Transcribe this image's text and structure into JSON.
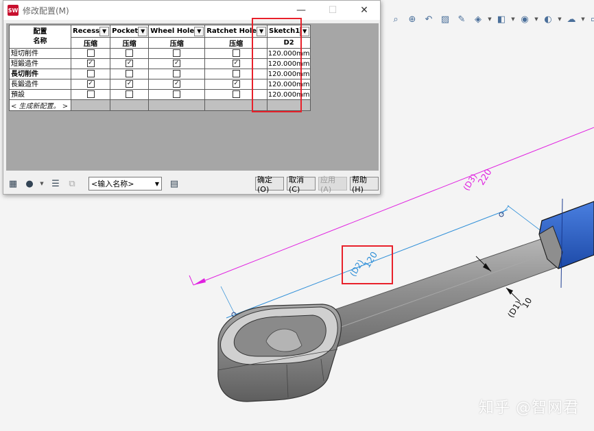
{
  "dialog": {
    "title": "修改配置(M)",
    "logo_text": "SW",
    "window_controls": {
      "minimize": "—",
      "maximize": "☐",
      "close": "✕"
    },
    "name_column_header_line1": "配置",
    "name_column_header_line2": "名称",
    "features": [
      {
        "name": "Recess",
        "param": "压缩"
      },
      {
        "name": "Pocket",
        "param": "压缩"
      },
      {
        "name": "Wheel Hole",
        "param": "压缩"
      },
      {
        "name": "Ratchet Hole",
        "param": "压缩"
      },
      {
        "name": "Sketch1",
        "param": "D2"
      }
    ],
    "rows": [
      {
        "name": "短切削件",
        "bold": false,
        "checks": [
          false,
          false,
          false,
          false
        ],
        "value": "120.000mm"
      },
      {
        "name": "短鍛造件",
        "bold": false,
        "checks": [
          true,
          true,
          true,
          true
        ],
        "value": "120.000mm"
      },
      {
        "name": "長切削件",
        "bold": true,
        "checks": [
          false,
          false,
          false,
          false
        ],
        "value": "120.000mm"
      },
      {
        "name": "長鍛造件",
        "bold": false,
        "checks": [
          true,
          true,
          true,
          true
        ],
        "value": "120.000mm"
      },
      {
        "name": "預設",
        "bold": false,
        "checks": [
          false,
          false,
          false,
          false
        ],
        "value": "120.000mm"
      }
    ],
    "new_config_label": "< 生成新配置。 >",
    "name_select_value": "<输入名称>",
    "buttons": {
      "ok": "确定(O)",
      "cancel": "取消(C)",
      "apply": "应用(A)",
      "help": "帮助(H)"
    }
  },
  "viewport": {
    "dimensions": [
      {
        "value": "220",
        "label": "(D3)",
        "color": "#e020e0"
      },
      {
        "value": "120",
        "label": "(D2)",
        "color": "#2f8fd8"
      },
      {
        "value": "10",
        "label": "(D1)",
        "color": "#111111"
      }
    ],
    "toolbar_icons": [
      "zoom-fit-icon",
      "zoom-area-icon",
      "previous-view-icon",
      "section-view-icon",
      "dynamic-annotation-icon",
      "view-orientation-icon",
      "display-style-icon",
      "hide-show-icon",
      "edit-appearance-icon",
      "scene-icon",
      "view-settings-icon"
    ]
  },
  "watermark": "知乎 @智网君",
  "colors": {
    "highlight_box": "#e8202a",
    "dim_d3": "#e020e0",
    "dim_d2": "#2f8fd8",
    "part_gray": "#9a9a9a",
    "part_blue": "#2e63c8"
  }
}
